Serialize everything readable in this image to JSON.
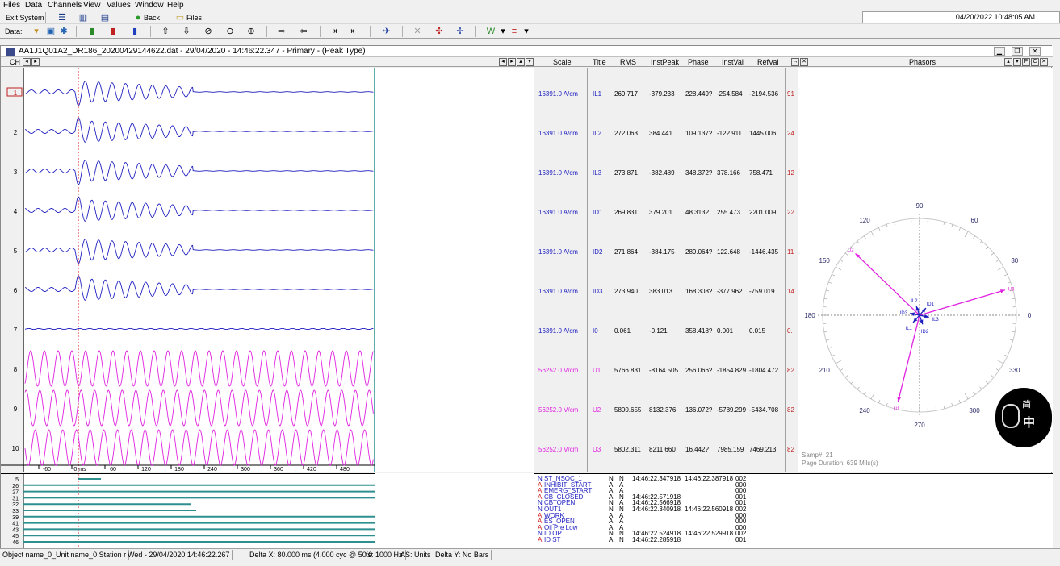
{
  "menu": [
    "Files",
    "Data",
    "Channels",
    "View",
    "Values",
    "Window",
    "Help"
  ],
  "toolbar1": {
    "exit": "Exit System",
    "back": "Back",
    "files": "Files"
  },
  "toolbar2": {
    "label": "Data:"
  },
  "datetime": "04/20/2022   10:48:05 AM",
  "window": {
    "title": "AA1J1Q01A2_DR186_20200429144622.dat - 29/04/2020 - 14:46:22.347 - Primary - (Peak Type)"
  },
  "headers": {
    "ch": "CH",
    "scale": "Scale",
    "title": "Title",
    "rms": "RMS",
    "instpeak": "InstPeak",
    "phase": "Phase",
    "instval": "InstVal",
    "refval": "RefVal",
    "phasors": "Phasors"
  },
  "channels": [
    {
      "num": "1",
      "scale": "16391.0 A/cm",
      "title": "IL1",
      "rms": "269.717",
      "instpeak": "-379.233",
      "phase": "228.449?",
      "instval": "-254.584",
      "refval": "-2194.536",
      "extra": "91",
      "type": "current"
    },
    {
      "num": "2",
      "scale": "16391.0 A/cm",
      "title": "IL2",
      "rms": "272.063",
      "instpeak": "384.441",
      "phase": "109.137?",
      "instval": "-122.911",
      "refval": "1445.006",
      "extra": "24",
      "type": "current"
    },
    {
      "num": "3",
      "scale": "16391.0 A/cm",
      "title": "IL3",
      "rms": "273.871",
      "instpeak": "-382.489",
      "phase": "348.372?",
      "instval": "378.166",
      "refval": "758.471",
      "extra": "12",
      "type": "current"
    },
    {
      "num": "4",
      "scale": "16391.0 A/cm",
      "title": "ID1",
      "rms": "269.831",
      "instpeak": "379.201",
      "phase": "48.313?",
      "instval": "255.473",
      "refval": "2201.009",
      "extra": "22",
      "type": "current"
    },
    {
      "num": "5",
      "scale": "16391.0 A/cm",
      "title": "ID2",
      "rms": "271.864",
      "instpeak": "-384.175",
      "phase": "289.064?",
      "instval": "122.648",
      "refval": "-1446.435",
      "extra": "11",
      "type": "current"
    },
    {
      "num": "6",
      "scale": "16391.0 A/cm",
      "title": "ID3",
      "rms": "273.940",
      "instpeak": "383.013",
      "phase": "168.308?",
      "instval": "-377.962",
      "refval": "-759.019",
      "extra": "14",
      "type": "current"
    },
    {
      "num": "7",
      "scale": "16391.0 A/cm",
      "title": "I0",
      "rms": "0.061",
      "instpeak": "-0.121",
      "phase": "358.418?",
      "instval": "0.001",
      "refval": "0.015",
      "extra": "0.",
      "type": "current"
    },
    {
      "num": "8",
      "scale": "56252.0 V/cm",
      "title": "U1",
      "rms": "5766.831",
      "instpeak": "-8164.505",
      "phase": "256.066?",
      "instval": "-1854.829",
      "refval": "-1804.472",
      "extra": "82",
      "type": "voltage"
    },
    {
      "num": "9",
      "scale": "56252.0 V/cm",
      "title": "U2",
      "rms": "5800.655",
      "instpeak": "8132.376",
      "phase": "136.072?",
      "instval": "-5789.299",
      "refval": "-5434.708",
      "extra": "82",
      "type": "voltage"
    },
    {
      "num": "10",
      "scale": "56252.0 V/cm",
      "title": "U3",
      "rms": "5802.311",
      "instpeak": "8211.660",
      "phase": "16.442?",
      "instval": "7985.159",
      "refval": "7469.213",
      "extra": "82",
      "type": "voltage"
    }
  ],
  "time_axis": {
    "ticks": [
      "-60",
      "0 ms",
      "60",
      "120",
      "180",
      "240",
      "300",
      "360",
      "420",
      "480"
    ]
  },
  "phasor": {
    "angles": [
      "90",
      "60",
      "30",
      "0",
      "330",
      "300",
      "270",
      "240",
      "210",
      "180",
      "150",
      "120"
    ],
    "vectors": [
      {
        "label": "U1",
        "angle": 256.066,
        "mag": 0.92,
        "color": "#e020e0"
      },
      {
        "label": "U2",
        "angle": 136.072,
        "mag": 0.92,
        "color": "#e020e0"
      },
      {
        "label": "U3",
        "angle": 16.442,
        "mag": 0.92,
        "color": "#e020e0"
      },
      {
        "label": "IL1",
        "angle": 228.449,
        "mag": 0.1,
        "color": "#2020c0"
      },
      {
        "label": "IL2",
        "angle": 109.137,
        "mag": 0.1,
        "color": "#2020c0"
      },
      {
        "label": "IL3",
        "angle": 348.372,
        "mag": 0.1,
        "color": "#2020c0"
      },
      {
        "label": "ID1",
        "angle": 48.313,
        "mag": 0.1,
        "color": "#2020c0"
      },
      {
        "label": "ID2",
        "angle": 289.064,
        "mag": 0.1,
        "color": "#2020c0"
      },
      {
        "label": "ID3",
        "angle": 168.308,
        "mag": 0.1,
        "color": "#2020c0"
      }
    ],
    "samp": "Samp#: 21",
    "duration": "Page Duration: 639 Mils(s)"
  },
  "binary_channels": [
    "5",
    "26",
    "27",
    "31",
    "32",
    "33",
    "39",
    "41",
    "43",
    "45",
    "46"
  ],
  "events": [
    {
      "flag": "N",
      "name": "ST_NSOC_1",
      "a": "N",
      "b": "N",
      "t1": "14:46:22.347918",
      "t2": "14:46:22.387918",
      "code": "002"
    },
    {
      "flag": "A",
      "name": "INHIBIT_START",
      "a": "A",
      "b": "A",
      "t1": "",
      "t2": "",
      "code": "000"
    },
    {
      "flag": "A",
      "name": "EMERG_START",
      "a": "A",
      "b": "A",
      "t1": "",
      "t2": "",
      "code": "000"
    },
    {
      "flag": "A",
      "name": "CB_CLOSED",
      "a": "A",
      "b": "N",
      "t1": "14:46:22.571918",
      "t2": "",
      "code": "001"
    },
    {
      "flag": "N",
      "name": "CB_OPEN",
      "a": "N",
      "b": "A",
      "t1": "14:46:22.566918",
      "t2": "",
      "code": "001"
    },
    {
      "flag": "N",
      "name": "OUT1",
      "a": "N",
      "b": "N",
      "t1": "14:46:22.340918",
      "t2": "14:46:22.560918",
      "code": "002"
    },
    {
      "flag": "A",
      "name": "WORK",
      "a": "A",
      "b": "A",
      "t1": "",
      "t2": "",
      "code": "000"
    },
    {
      "flag": "A",
      "name": "ES_OPEN",
      "a": "A",
      "b": "A",
      "t1": "",
      "t2": "",
      "code": "000"
    },
    {
      "flag": "A",
      "name": "Oil Pre Low",
      "a": "A",
      "b": "A",
      "t1": "",
      "t2": "",
      "code": "000"
    },
    {
      "flag": "N",
      "name": "ID OP",
      "a": "N",
      "b": "N",
      "t1": "14:46:22.524918",
      "t2": "14:46:22.529918",
      "code": "002"
    },
    {
      "flag": "A",
      "name": "ID ST",
      "a": "A",
      "b": "N",
      "t1": "14:46:22.285918",
      "t2": "",
      "code": "001"
    }
  ],
  "status": {
    "object": "Object name_0_Unit name_0 Station r",
    "time": "Wed - 29/04/2020 14:46:22.267",
    "delta": "Delta X: 80.000 ms  (4.000 cyc @ 50.0",
    "fs": "fs:  1000 Hz",
    "as": "AS: Units",
    "deltay": "Delta Y:  No Bars"
  },
  "badge": {
    "top": "简",
    "main": "中"
  },
  "colors": {
    "current": "#2020c0",
    "voltage": "#e020e0",
    "teal": "#2f8f8f",
    "red": "#e02020"
  }
}
